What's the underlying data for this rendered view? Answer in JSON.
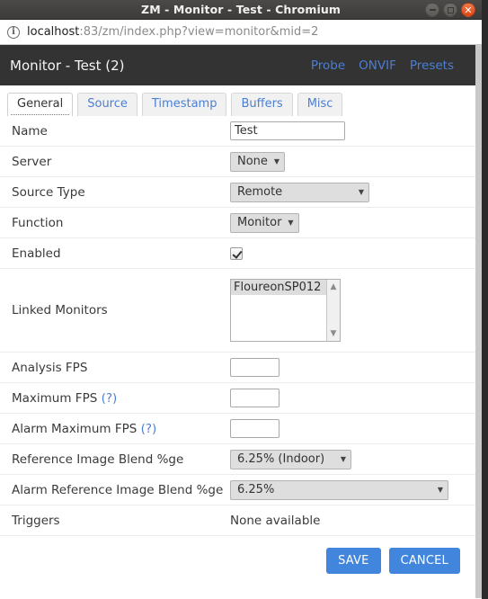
{
  "window": {
    "title": "ZM - Monitor - Test - Chromium",
    "buttons": {
      "minimize": "minimize-button",
      "maximize": "maximize-button",
      "close": "close-button"
    }
  },
  "browser": {
    "info_icon": "info-icon",
    "url_host": "localhost",
    "url_rest": ":83/zm/index.php?view=monitor&mid=2"
  },
  "header": {
    "title": "Monitor - Test (2)",
    "links": [
      {
        "label": "Probe"
      },
      {
        "label": "ONVIF"
      },
      {
        "label": "Presets"
      }
    ]
  },
  "tabs": [
    {
      "label": "General",
      "active": true
    },
    {
      "label": "Source",
      "active": false
    },
    {
      "label": "Timestamp",
      "active": false
    },
    {
      "label": "Buffers",
      "active": false
    },
    {
      "label": "Misc",
      "active": false
    }
  ],
  "form": {
    "name": {
      "label": "Name",
      "value": "Test"
    },
    "server": {
      "label": "Server",
      "value": "None"
    },
    "source_type": {
      "label": "Source Type",
      "value": "Remote"
    },
    "function": {
      "label": "Function",
      "value": "Monitor"
    },
    "enabled": {
      "label": "Enabled",
      "checked": true
    },
    "linked_monitors": {
      "label": "Linked Monitors",
      "options": [
        "FloureonSP012"
      ]
    },
    "analysis_fps": {
      "label": "Analysis FPS",
      "value": ""
    },
    "maximum_fps": {
      "label": "Maximum FPS",
      "help": "(?)",
      "value": ""
    },
    "alarm_maximum_fps": {
      "label": "Alarm Maximum FPS",
      "help": "(?)",
      "value": ""
    },
    "reference_blend": {
      "label": "Reference Image Blend %ge",
      "value": "6.25% (Indoor)"
    },
    "alarm_reference_blend": {
      "label": "Alarm Reference Image Blend %ge",
      "value": "6.25%"
    },
    "triggers": {
      "label": "Triggers",
      "value": "None available"
    }
  },
  "actions": {
    "save": "SAVE",
    "cancel": "CANCEL"
  },
  "colors": {
    "accent": "#4285dd",
    "link": "#4a7fd4",
    "header_bg": "#333333",
    "close_btn": "#dd4814"
  }
}
